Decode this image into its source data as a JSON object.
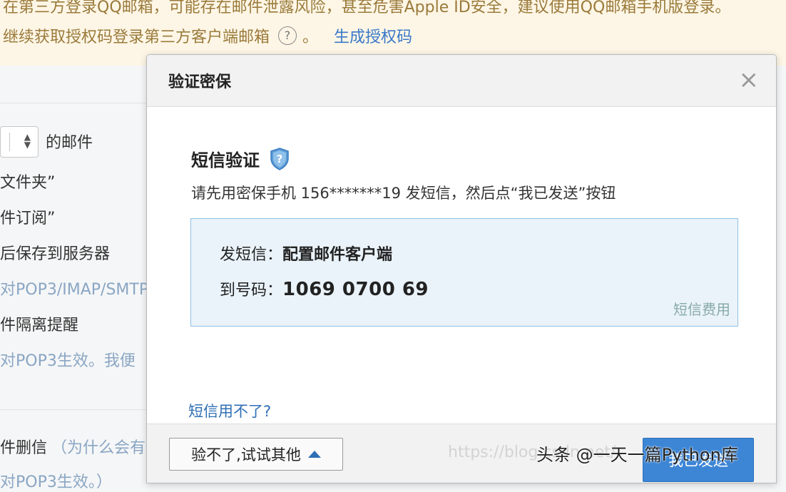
{
  "banner": {
    "line1": "在第三方登录QQ邮箱，可能存在邮件泄露风险，甚至危害Apple ID安全，建议使用QQ邮箱手机版登录。",
    "line2": "继续获取授权码登录第三方客户端邮箱",
    "help_glyph": "?",
    "line2_suffix": "。",
    "generate_link": "生成授权码"
  },
  "background": {
    "select_suffix": "的邮件",
    "items": [
      "文件夹”",
      "件订阅”",
      "后保存到服务器",
      "对POP3/IMAP/SMTP",
      "件隔离提醒",
      "对POP3生效。我便",
      "件删信",
      "（为什么会有",
      "对POP3生效。）"
    ]
  },
  "modal": {
    "title": "验证密保",
    "close_glyph": "×",
    "heading": "短信验证",
    "instruction": "请先用密保手机 156*******19 发短信，然后点“我已发送”按钮",
    "sms_label": "发短信：",
    "sms_content": "配置邮件客户端",
    "number_label": "到号码：",
    "number_value": "1069 0700 69",
    "fee_link": "短信费用",
    "cant_sms_link": "短信用不了?",
    "try_other_button": "验不了,试试其他",
    "sent_button": "我已发送"
  },
  "watermarks": {
    "url": "https://blog.csdn.net/",
    "source": "头条 @一天一篇Python库"
  },
  "colors": {
    "link": "#2e6fb5",
    "primary_button": "#3d86d6",
    "banner_bg": "#fdf6e6",
    "sms_box_bg": "#eaf3fa"
  },
  "icons": [
    "help-icon",
    "close-icon",
    "shield-question-icon",
    "caret-up-icon",
    "select-arrows-icon"
  ]
}
